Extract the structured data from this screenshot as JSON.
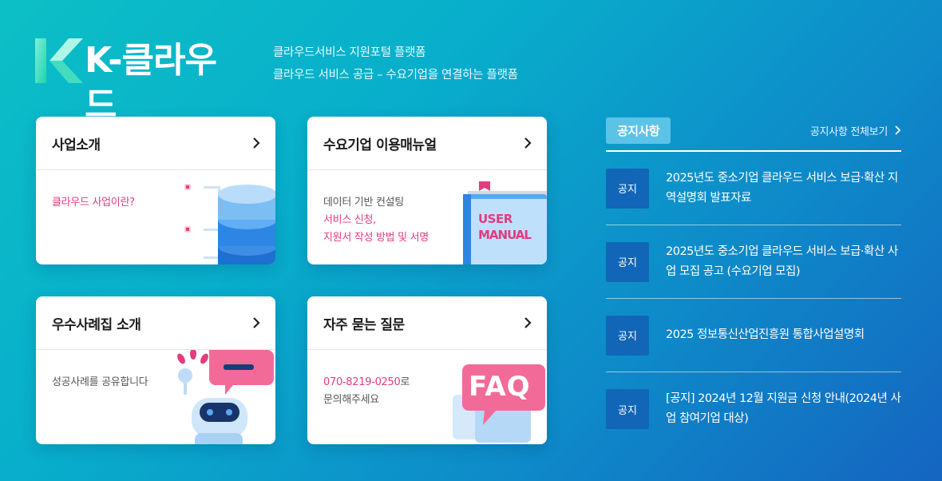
{
  "header": {
    "logo_text": "K-클라우드",
    "tagline_1": "클라우드서비스 지원포털 플랫폼",
    "tagline_2": "클라우드 서비스 공급 – 수요기업을 연결하는 플랫폼"
  },
  "cards": [
    {
      "title": "사업소개",
      "lines": [
        "클라우드 사업이란?"
      ]
    },
    {
      "title": "수요기업 이용매뉴얼",
      "lines": [
        "데이터 기반 컨설팅",
        "서비스 신청,",
        "지원서 작성 방법 및 서명"
      ],
      "illustration_text": [
        "USER",
        "MANUAL"
      ]
    },
    {
      "title": "우수사례집 소개",
      "lines": [
        "성공사례를 공유합니다"
      ]
    },
    {
      "title": "자주 묻는 질문",
      "phone": "070-8219-0250",
      "phone_suffix": "로",
      "line2": "문의해주세요",
      "illustration_text": "FAQ"
    }
  ],
  "notice": {
    "badge": "공지사항",
    "more_label": "공지사항 전체보기",
    "items": [
      {
        "tag": "공지",
        "title": "2025년도 중소기업 클라우드 서비스 보급·확산 지역설명회 발표자료"
      },
      {
        "tag": "공지",
        "title": "2025년도 중소기업 클라우드 서비스 보급·확산 사업 모집 공고 (수요기업 모집)"
      },
      {
        "tag": "공지",
        "title": "2025 정보통신산업진흥원 통합사업설명회"
      },
      {
        "tag": "공지",
        "title": "[공지] 2024년 12월 지원금 신청 안내(2024년 사업 참여기업 대상)"
      }
    ]
  },
  "colors": {
    "accent_pink": "#e23c7f",
    "notice_tag": "#1166b8",
    "badge": "#5cc3e6"
  }
}
